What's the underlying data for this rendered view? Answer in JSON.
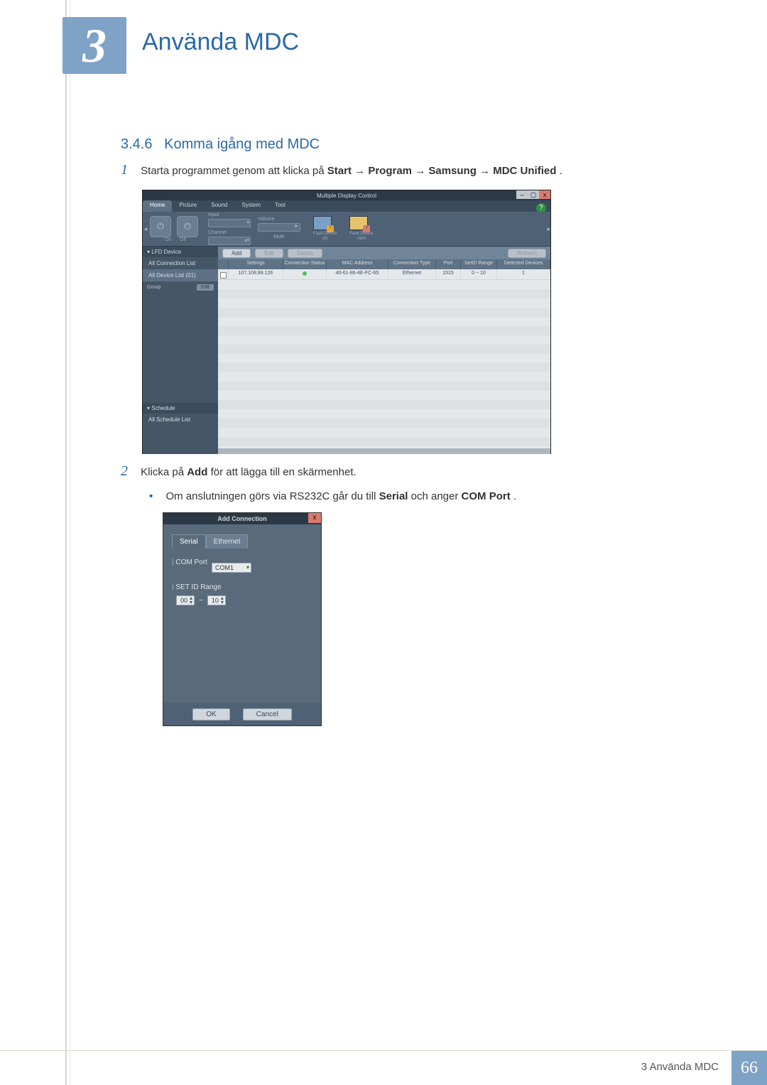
{
  "chapter_number": "3",
  "chapter_title": "Använda MDC",
  "section_number": "3.4.6",
  "section_title": "Komma igång med MDC",
  "step1": {
    "num": "1",
    "pre": "Starta programmet genom att klicka på ",
    "b1": "Start",
    "arrow": " → ",
    "b2": "Program",
    "b3": "Samsung",
    "b4": "MDC Unified",
    "period": "."
  },
  "step2": {
    "num": "2",
    "pre": "Klicka på ",
    "b1": "Add",
    "post": " för att lägga till en skärmenhet."
  },
  "bullet": {
    "dot": "•",
    "pre": "Om anslutningen görs via RS232C går du till ",
    "b1": "Serial",
    "mid": " och anger ",
    "b2": "COM Port",
    "post": "."
  },
  "fig1": {
    "title": "Multiple Display Control",
    "help": "?",
    "win_min": "–",
    "win_max": "▢",
    "win_close": "x",
    "tabs": [
      "Home",
      "Picture",
      "Sound",
      "System",
      "Tool"
    ],
    "arrow_l": "◄",
    "arrow_r": "►",
    "power_on": "On",
    "power_off": "Off",
    "input_lbl": "Input",
    "channel_lbl": "Channel",
    "volume_lbl": "Volume",
    "mute_lbl": "Mute",
    "volume_play": "►",
    "fault0_lbl1": "Fault Device",
    "fault0_lbl2": "(0)",
    "fault1_lbl1": "Fault Device",
    "fault1_lbl2": "Alert",
    "side_lfd": "▾  LFD Device",
    "side_all_conn": "All Connection List",
    "side_all_dev": "All Device List (01)",
    "side_group": "Group",
    "side_edit": "Edit",
    "side_schedule": "▾  Schedule",
    "side_all_sched": "All Schedule List",
    "btn_add": "Add",
    "btn_edit": "Edit",
    "btn_delete": "Delete",
    "btn_refresh": "Refresh",
    "thead": [
      "",
      "Settings",
      "Connection Status",
      "MAC Address",
      "Connection Type",
      "Port",
      "SetID Range",
      "Detected Devices"
    ],
    "row": [
      "",
      "107.108.89.126",
      "",
      "40-61-86-4E-FC-65",
      "Ethernet",
      "1515",
      "0 ~ 10",
      "1"
    ]
  },
  "fig2": {
    "title": "Add Connection",
    "close": "x",
    "tab_serial": "Serial",
    "tab_ethernet": "Ethernet",
    "comport_lbl": "COM Port",
    "comport_val": "COM1",
    "setid_lbl": "SET ID Range",
    "range_from": "00",
    "range_sep": "~",
    "range_to": "10",
    "ok": "OK",
    "cancel": "Cancel"
  },
  "footer": {
    "text": "3 Använda MDC",
    "page": "66"
  }
}
